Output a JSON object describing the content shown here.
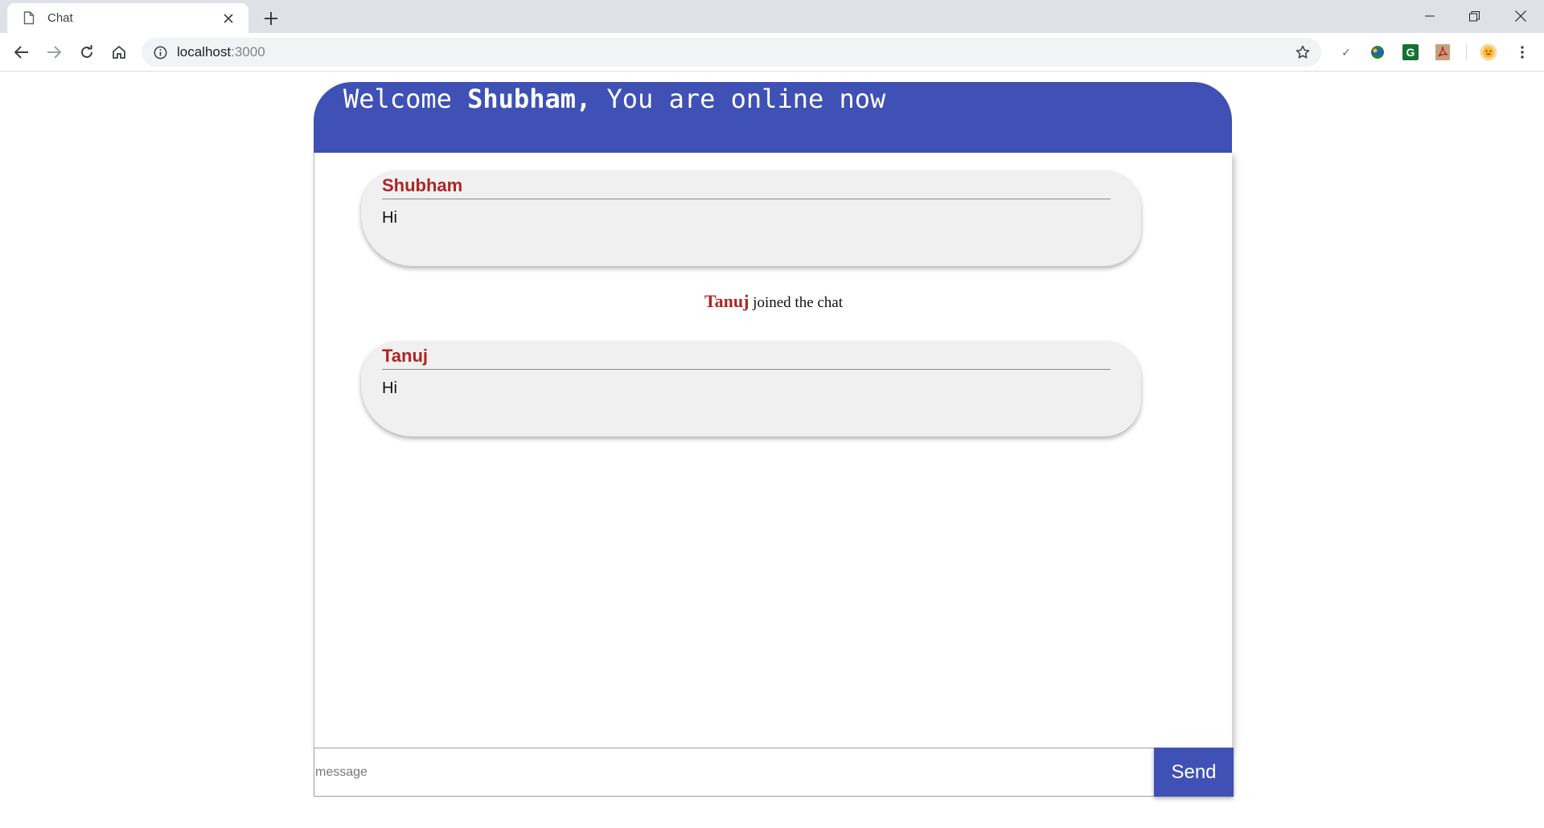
{
  "browser": {
    "tab_title": "Chat",
    "url_host": "localhost",
    "url_port": ":3000"
  },
  "header": {
    "welcome": "Welcome ",
    "username": "Shubham,",
    "status": " You are online now"
  },
  "messages": [
    {
      "sender": "Shubham",
      "text": "Hi"
    },
    {
      "sender": "Tanuj",
      "text": "Hi"
    }
  ],
  "notice": {
    "name": "Tanuj",
    "text": " joined the chat"
  },
  "composer": {
    "placeholder": "message",
    "send_label": "Send"
  },
  "colors": {
    "accent": "#3f51b5",
    "username": "#b02424",
    "bubble": "#f0f0f0"
  },
  "icons": [
    "page-icon",
    "close-icon",
    "plus-icon",
    "back-icon",
    "forward-icon",
    "reload-icon",
    "home-icon",
    "info-icon",
    "star-icon"
  ]
}
